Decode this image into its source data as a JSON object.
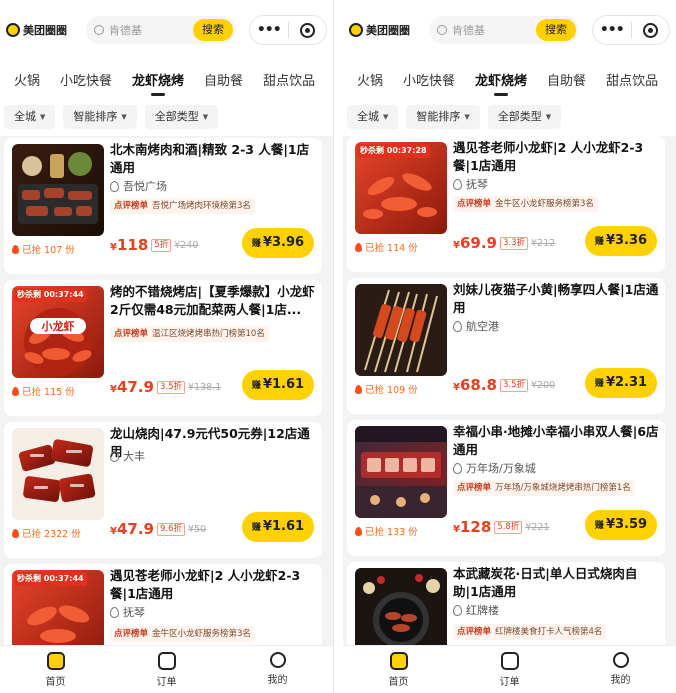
{
  "colors": {
    "accent": "#ffd100",
    "price": "#e6401e",
    "flash": "#e0301e"
  },
  "panels": [
    {
      "header": {
        "app_name": "美团圈圈",
        "search_placeholder": "肯德基",
        "search_button": "搜索",
        "more_icon": "more-dots-icon",
        "target_icon": "target-icon"
      },
      "tabs": [
        "火锅",
        "小吃快餐",
        "龙虾烧烤",
        "自助餐",
        "甜点饮品"
      ],
      "active_tab": 2,
      "filters": [
        "全城",
        "智能排序",
        "全部类型"
      ],
      "cards": [
        {
          "title": "北木南烤肉和酒|精致 2-3 人餐|1店通用",
          "flash": "",
          "location": "吾悦广场",
          "rank_tag": "点评榜单",
          "rank_text": "吾悦广场烤肉环境榜第3名",
          "sold": "已抢 107 份",
          "price_symbol": "¥",
          "price": "118",
          "discount": "5折",
          "original_price": "¥240",
          "earn_label": "赚",
          "earn": "¥3.96"
        },
        {
          "title": "烤的不错烧烤店|【夏季爆款】小龙虾2斤仅需48元加配菜两人餐|1店...",
          "flash": "秒杀剩 00:37:44",
          "location": "",
          "rank_tag": "点评榜单",
          "rank_text": "温江区烧烤烤串热门榜第10名",
          "sold": "已抢 115 份",
          "price_symbol": "¥",
          "price": "47.9",
          "discount": "3.5折",
          "original_price": "¥138.1",
          "earn_label": "赚",
          "earn": "¥1.61"
        },
        {
          "title": "龙山烧肉|47.9元代50元券|12店通用",
          "flash": "",
          "location": "大丰",
          "rank_tag": "",
          "rank_text": "",
          "sold": "已抢 2322 份",
          "price_symbol": "¥",
          "price": "47.9",
          "discount": "9.6折",
          "original_price": "¥50",
          "earn_label": "赚",
          "earn": "¥1.61"
        },
        {
          "title": "遇见苍老师小龙虾|2 人小龙虾2-3餐|1店通用",
          "flash": "秒杀剩 00:37:44",
          "location": "抚琴",
          "rank_tag": "点评榜单",
          "rank_text": "金牛区小龙虾服务榜第3名",
          "sold": "",
          "price_symbol": "",
          "price": "",
          "discount": "",
          "original_price": "",
          "earn_label": "",
          "earn": ""
        }
      ],
      "navbar": [
        {
          "label": "首页",
          "icon": "home-icon"
        },
        {
          "label": "订单",
          "icon": "order-icon"
        },
        {
          "label": "我的",
          "icon": "profile-icon"
        }
      ]
    },
    {
      "header": {
        "app_name": "美团圈圈",
        "search_placeholder": "肯德基",
        "search_button": "搜索",
        "more_icon": "more-dots-icon",
        "target_icon": "target-icon"
      },
      "tabs": [
        "火锅",
        "小吃快餐",
        "龙虾烧烤",
        "自助餐",
        "甜点饮品"
      ],
      "active_tab": 2,
      "filters": [
        "全城",
        "智能排序",
        "全部类型"
      ],
      "cards": [
        {
          "title": "遇见苍老师小龙虾|2 人小龙虾2-3餐|1店通用",
          "flash": "秒杀剩 00:37:28",
          "location": "抚琴",
          "rank_tag": "点评榜单",
          "rank_text": "金牛区小龙虾服务榜第3名",
          "sold": "已抢 114 份",
          "price_symbol": "¥",
          "price": "69.9",
          "discount": "3.3折",
          "original_price": "¥212",
          "earn_label": "赚",
          "earn": "¥3.36"
        },
        {
          "title": "刘妹儿夜猫子小黄|畅享四人餐|1店通用",
          "flash": "",
          "location": "航空港",
          "rank_tag": "",
          "rank_text": "",
          "sold": "已抢 109 份",
          "price_symbol": "¥",
          "price": "68.8",
          "discount": "3.5折",
          "original_price": "¥200",
          "earn_label": "赚",
          "earn": "¥2.31"
        },
        {
          "title": "幸福小串·地摊小幸福小串双人餐|6店通用",
          "flash": "",
          "location": "万年场/万象城",
          "rank_tag": "点评榜单",
          "rank_text": "万年场/万象城烧烤烤串热门榜第1名",
          "sold": "已抢 133 份",
          "price_symbol": "¥",
          "price": "128",
          "discount": "5.8折",
          "original_price": "¥221",
          "earn_label": "赚",
          "earn": "¥3.59"
        },
        {
          "title": "本武藏炭花·日式|单人日式烧肉自助|1店通用",
          "flash": "",
          "location": "红牌楼",
          "rank_tag": "点评榜单",
          "rank_text": "红牌楼美食打卡人气榜第4名",
          "sold": "",
          "price_symbol": "",
          "price": "",
          "discount": "",
          "original_price": "",
          "earn_label": "",
          "earn": ""
        }
      ],
      "navbar": [
        {
          "label": "首页",
          "icon": "home-icon"
        },
        {
          "label": "订单",
          "icon": "order-icon"
        },
        {
          "label": "我的",
          "icon": "profile-icon"
        }
      ]
    }
  ]
}
